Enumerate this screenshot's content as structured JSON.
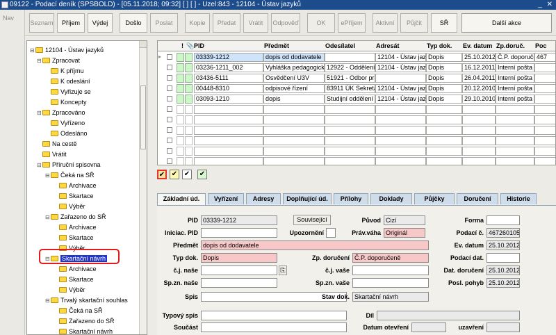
{
  "title": "09122 - Podací deník (SPSBOLD) - [05.11.2018; 09:32] [ ] [ ] - Uzel:843 - 12104 - Ústav jazyků",
  "window_controls": "_ ✕",
  "nav_label": "Nav",
  "toolbar": {
    "buttons": [
      "Seznam",
      "Příjem",
      "Výdej",
      "Došlo",
      "Poslat",
      "Kopie",
      "Předat",
      "Vrátit",
      "Odpověď",
      "OK",
      "ePříjem",
      "Aktivní",
      "Půjčit",
      "SŘ",
      "Další akce"
    ]
  },
  "tree": {
    "nodes": [
      "12104 - Ústav jazyků",
      "Zpracovat",
      "K příjmu",
      "K odeslání",
      "Vyřizuje se",
      "Koncepty",
      "Zpracováno",
      "Vyřízeno",
      "Odesláno",
      "Na cestě",
      "Vrátit",
      "Příruční spisovna",
      "Čeká na SŘ",
      "Archivace",
      "Skartace",
      "Výběr",
      "Zařazeno do SŘ",
      "Archivace",
      "Skartace",
      "Výběr",
      "Skartační návrh",
      "Archivace",
      "Skartace",
      "Výběr",
      "Trvalý skartační souhlas",
      "Čeká na SŘ",
      "Zařazeno do SŘ",
      "Skartační návrh"
    ],
    "selected": "Skartační návrh"
  },
  "grid": {
    "columns": [
      "!",
      "📎",
      "PID",
      "Předmět",
      "Odesílatel",
      "Adresát",
      "Typ dok.",
      "Ev. datum",
      "Zp.doruč.",
      "Poc"
    ],
    "rows": [
      [
        "03339-1212",
        "dopis od dodavatele",
        "",
        "12104 - Ústav jazy",
        "Dopis",
        "25.10.2012",
        "Č.P. doporuče",
        "467"
      ],
      [
        "03236-1211_002",
        "Vyhláška pedagogické",
        "12922 - Oddělení s",
        "12104 - Ústav jazy",
        "Dopis",
        "16.12.2011",
        "Interní pošta",
        ""
      ],
      [
        "03436-5111",
        "Osvědčení U3V",
        "51921 - Odbor pro",
        "",
        "Dopis",
        "26.04.2011",
        "Interní pošta",
        ""
      ],
      [
        "00448-8310",
        "odpisové řízení",
        "83911 ÚK Sekretař",
        "12104 - Ústav jazy",
        "Dopis",
        "20.12.2010",
        "Interní pošta",
        ""
      ],
      [
        "03093-1210",
        "dopis",
        "Studijní oddělení",
        "12104 - Ústav jazy",
        "Dopis",
        "29.10.2010",
        "Interní pošta",
        ""
      ]
    ],
    "empty_rows": 7
  },
  "legend": [
    "✔",
    "✔",
    "✔",
    "✔"
  ],
  "tabs": [
    "Základní úd.",
    "Vyřízení",
    "Adresy",
    "Doplňující úd.",
    "Přílohy",
    "Doklady",
    "Půjčky",
    "Doručení",
    "Historie"
  ],
  "form": {
    "pid_label": "PID",
    "pid": "03339-1212",
    "souvisejici": "Související",
    "puvod_label": "Původ",
    "puvod": "Cizí",
    "forma_label": "Forma",
    "forma": "",
    "iniciac_label": "Iniciac. PID",
    "iniciac": "",
    "upozorneni_label": "Upozornění",
    "upozorneni": "",
    "pravvaha_label": "Práv.váha",
    "pravvaha": "Originál",
    "podacic_label": "Podací č.",
    "podacic": "467260105",
    "predmet_label": "Předmět",
    "predmet": "dopis od dodavatele",
    "evdatum_label": "Ev. datum",
    "evdatum": "25.10.2012",
    "typdok_label": "Typ dok.",
    "typdok": "Dopis",
    "zpdoruc_label": "Zp. doručení",
    "zpdoruc": "Č.P. doporučeně",
    "podacidat_label": "Podací dat.",
    "podacidat": "",
    "cjnase_label": "č.j. naše",
    "cjnase": "",
    "cjvase_label": "č.j. vaše",
    "cjvase": "",
    "datdoruc_label": "Dat. doručení",
    "datdoruc": "25.10.2012",
    "spznnase_label": "Sp.zn. naše",
    "spznnase": "",
    "spznvase_label": "Sp.zn. vaše",
    "spznvase": "",
    "poslpohyb_label": "Posl. pohyb",
    "poslpohyb": "25.10.2012",
    "spis_label": "Spis",
    "spis": "",
    "stavdok_label": "Stav dok.",
    "stavdok": "Skartační návrh",
    "typovy_label": "Typový spis",
    "typovy": "",
    "dil_label": "Díl",
    "dil": "",
    "soucast_label": "Součást",
    "soucast": "",
    "datumotev_label": "Datum otevření",
    "datumotev": "",
    "uzavreni_label": "uzavření",
    "uzavreni": ""
  }
}
